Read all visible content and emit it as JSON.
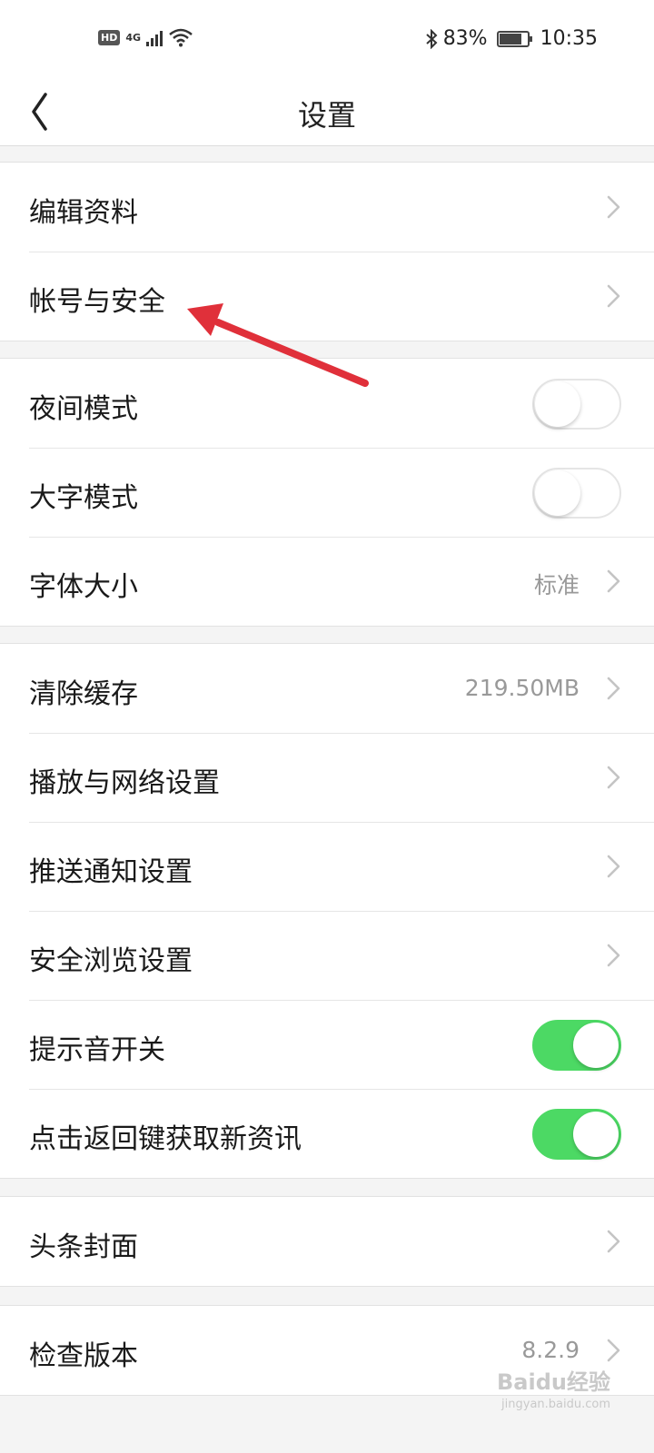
{
  "status_bar": {
    "hd": "HD",
    "network": "4G",
    "battery_percent": "83%",
    "battery_level": 0.83,
    "time": "10:35",
    "icons": [
      "hd-icon",
      "signal-icon",
      "wifi-icon",
      "bluetooth-icon",
      "battery-icon"
    ]
  },
  "header": {
    "title": "设置",
    "back_icon": "chevron-left-icon"
  },
  "groups": [
    {
      "items": [
        {
          "label": "编辑资料",
          "type": "link"
        },
        {
          "label": "帐号与安全",
          "type": "link"
        }
      ]
    },
    {
      "items": [
        {
          "label": "夜间模式",
          "type": "toggle",
          "on": false
        },
        {
          "label": "大字模式",
          "type": "toggle",
          "on": false
        },
        {
          "label": "字体大小",
          "type": "link",
          "value": "标准"
        }
      ]
    },
    {
      "items": [
        {
          "label": "清除缓存",
          "type": "link",
          "value": "219.50MB"
        },
        {
          "label": "播放与网络设置",
          "type": "link"
        },
        {
          "label": "推送通知设置",
          "type": "link"
        },
        {
          "label": "安全浏览设置",
          "type": "link"
        },
        {
          "label": "提示音开关",
          "type": "toggle",
          "on": true
        },
        {
          "label": "点击返回键获取新资讯",
          "type": "toggle",
          "on": true
        }
      ]
    },
    {
      "items": [
        {
          "label": "头条封面",
          "type": "link"
        }
      ]
    },
    {
      "items": [
        {
          "label": "检查版本",
          "type": "link",
          "value": "8.2.9"
        }
      ]
    }
  ],
  "annotation": {
    "color": "#e0303a",
    "points_to": "帐号与安全"
  },
  "colors": {
    "toggle_on": "#4cd964",
    "background": "#f4f4f4"
  },
  "watermark": {
    "text": "Baidu经验",
    "sub": "jingyan.baidu.com"
  }
}
